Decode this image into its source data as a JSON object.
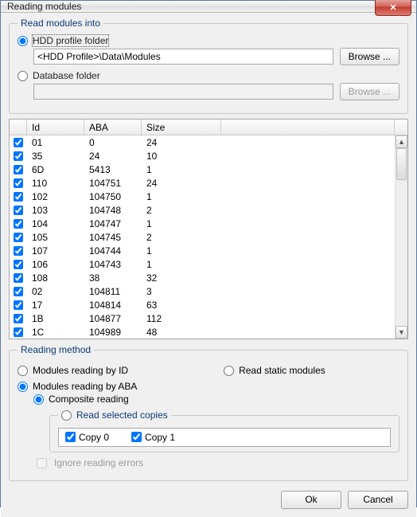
{
  "window": {
    "title": "Reading modules",
    "close_icon": "✕"
  },
  "read_into": {
    "legend": "Read modules into",
    "opt_profile": "HDD profile folder",
    "profile_path": "<HDD Profile>\\Data\\Modules",
    "opt_database": "Database folder",
    "database_path": "",
    "browse": "Browse ..."
  },
  "columns": {
    "id": "Id",
    "aba": "ABA",
    "size": "Size"
  },
  "rows": [
    {
      "id": "01",
      "aba": "0",
      "size": "24"
    },
    {
      "id": "35",
      "aba": "24",
      "size": "10"
    },
    {
      "id": "6D",
      "aba": "5413",
      "size": "1"
    },
    {
      "id": "110",
      "aba": "104751",
      "size": "24"
    },
    {
      "id": "102",
      "aba": "104750",
      "size": "1"
    },
    {
      "id": "103",
      "aba": "104748",
      "size": "2"
    },
    {
      "id": "104",
      "aba": "104747",
      "size": "1"
    },
    {
      "id": "105",
      "aba": "104745",
      "size": "2"
    },
    {
      "id": "107",
      "aba": "104744",
      "size": "1"
    },
    {
      "id": "106",
      "aba": "104743",
      "size": "1"
    },
    {
      "id": "108",
      "aba": "38",
      "size": "32"
    },
    {
      "id": "02",
      "aba": "104811",
      "size": "3"
    },
    {
      "id": "17",
      "aba": "104814",
      "size": "63"
    },
    {
      "id": "1B",
      "aba": "104877",
      "size": "112"
    },
    {
      "id": "1C",
      "aba": "104989",
      "size": "48"
    }
  ],
  "method": {
    "legend": "Reading method",
    "by_id": "Modules reading by ID",
    "static": "Read static modules",
    "by_aba": "Modules reading by ABA",
    "composite": "Composite reading",
    "read_selected_legend": "Read selected copies",
    "copy0": "Copy 0",
    "copy1": "Copy 1",
    "ignore": "Ignore reading errors"
  },
  "footer": {
    "ok": "Ok",
    "cancel": "Cancel"
  }
}
